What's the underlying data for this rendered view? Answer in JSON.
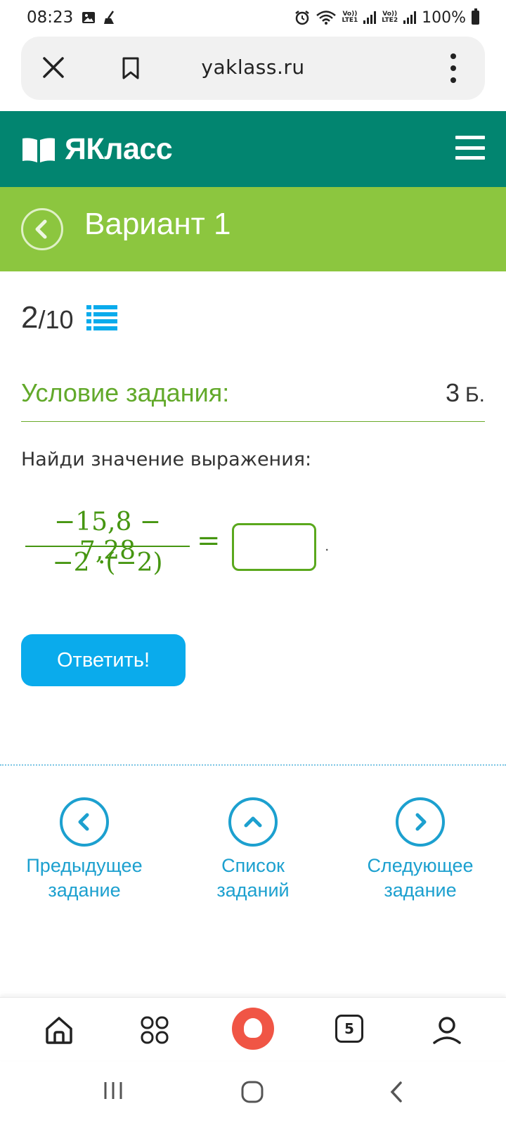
{
  "status_bar": {
    "time": "08:23",
    "lte1": "Vo))\nLTE1",
    "lte1_top": "Vo))",
    "lte1_bottom": "LTE1",
    "lte2_top": "Vo))",
    "lte2_bottom": "LTE2",
    "battery": "100%",
    "icons": [
      "gallery-icon",
      "broom-icon",
      "alarm-icon",
      "wifi-icon",
      "signal-icon",
      "battery-icon"
    ]
  },
  "browser": {
    "url": "yaklass.ru",
    "icons": [
      "close-icon",
      "bookmark-icon",
      "more-icon"
    ]
  },
  "site": {
    "logo_text": "ЯКласс",
    "accent": "#028570",
    "title_bar_color": "#8cc63f"
  },
  "page": {
    "title": "Вариант 1",
    "progress_current": "2",
    "progress_total": "/10"
  },
  "task": {
    "condition_label": "Условие задания:",
    "points_value": "3",
    "points_unit": "Б.",
    "question": "Найди значение выражения:",
    "numerator": "−15,8 − 7,28",
    "denominator": "−2 ·(−2)",
    "equals": "=",
    "answer_value": "",
    "period": ".",
    "submit_label": "Ответить!"
  },
  "navigation": {
    "prev_line1": "Предыдущее",
    "prev_line2": "задание",
    "list_line1": "Список",
    "list_line2": "заданий",
    "next_line1": "Следующее",
    "next_line2": "задание"
  },
  "browser_nav": {
    "tab_count": "5",
    "icons": [
      "home-icon",
      "apps-icon",
      "alice-icon",
      "tabs-icon",
      "profile-icon"
    ]
  }
}
